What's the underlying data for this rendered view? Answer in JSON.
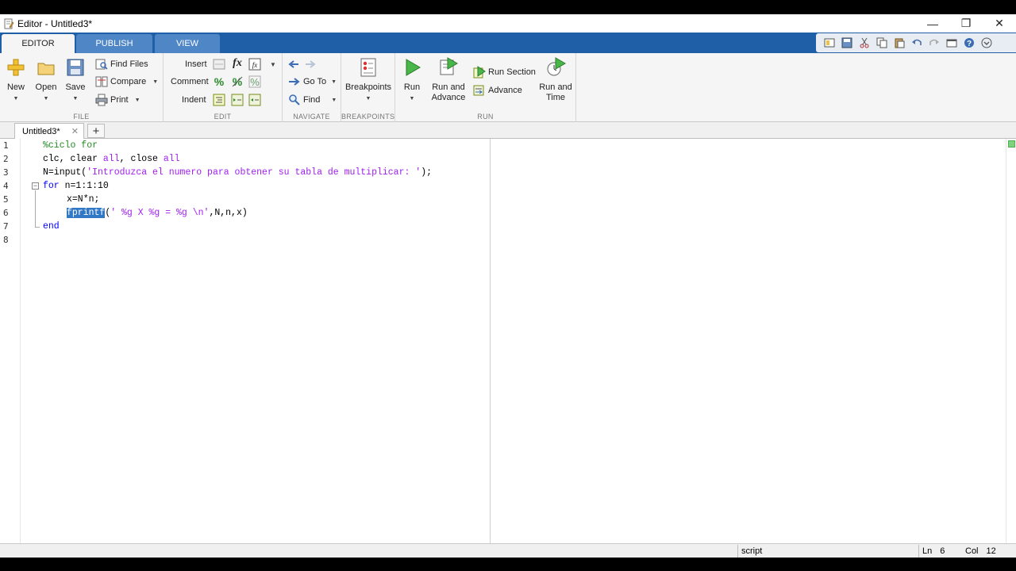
{
  "window": {
    "title": "Editor - Untitled3*",
    "controls": {
      "minimize": "—",
      "restore": "❐",
      "close": "✕"
    }
  },
  "ribbon_tabs": [
    {
      "label": "EDITOR",
      "active": true
    },
    {
      "label": "PUBLISH",
      "active": false
    },
    {
      "label": "VIEW",
      "active": false
    }
  ],
  "file_group": {
    "label": "FILE",
    "new": "New",
    "open": "Open",
    "save": "Save",
    "find_files": "Find Files",
    "compare": "Compare",
    "print": "Print"
  },
  "edit_group": {
    "label": "EDIT",
    "insert": "Insert",
    "comment": "Comment",
    "indent": "Indent",
    "fx": "fx"
  },
  "navigate_group": {
    "label": "NAVIGATE",
    "go_to": "Go To",
    "find": "Find"
  },
  "breakpoints_group": {
    "label": "BREAKPOINTS",
    "breakpoints": "Breakpoints"
  },
  "run_group": {
    "label": "RUN",
    "run": "Run",
    "run_and_advance_1": "Run and",
    "run_and_advance_2": "Advance",
    "run_section": "Run Section",
    "advance": "Advance",
    "run_and_time_1": "Run and",
    "run_and_time_2": "Time"
  },
  "document_tab": {
    "label": "Untitled3*",
    "close": "✕",
    "add": "+"
  },
  "code_lines": [
    {
      "n": "1",
      "comment": "%ciclo for"
    },
    {
      "n": "2",
      "a": "clc, clear ",
      "b": "all",
      "c": ", close ",
      "d": "all"
    },
    {
      "n": "3",
      "a": "N=input(",
      "str": "'Introduzca el numero para obtener su tabla de multiplicar: '",
      "c": ");"
    },
    {
      "n": "4",
      "kw": "for",
      "rest": " n=1:1:10"
    },
    {
      "n": "5",
      "text": "x=N*n;"
    },
    {
      "n": "6",
      "selected": "fprintf",
      "a": "(",
      "str": "' %g X %g = %g \\n'",
      "c": ",N,n,x)"
    },
    {
      "n": "7",
      "kw": "end"
    },
    {
      "n": "8"
    }
  ],
  "status_bar": {
    "mode": "script",
    "ln_label": "Ln",
    "ln_value": "6",
    "col_label": "Col",
    "col_value": "12"
  },
  "colors": {
    "ribbon_blue": "#1f5fa7",
    "keyword": "#0000ff",
    "comment": "#228b22",
    "string": "#a020f0",
    "selection": "#3178c6"
  }
}
